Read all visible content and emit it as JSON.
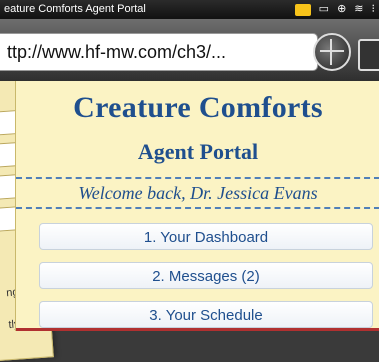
{
  "statusbar": {
    "title": "eature Comforts Agent Portal"
  },
  "browser": {
    "url": "ttp://www.hf-mw.com/ch3/..."
  },
  "page": {
    "title": "Creature Comforts",
    "subtitle": "Agent Portal",
    "welcome": "Welcome back, Dr. Jessica Evans",
    "nav": [
      {
        "label": "1. Your Dashboard"
      },
      {
        "label": "2. Messages (2)"
      },
      {
        "label": "3. Your Schedule"
      }
    ]
  },
  "back_page": {
    "text1": "ng",
    "text2": "tly"
  },
  "colors": {
    "accent": "#1f4f8e",
    "page_bg": "#fbf3c4",
    "statusbar_bg": "#111111"
  },
  "icons": [
    "chat-icon",
    "battery-icon",
    "signal-icon",
    "wifi-icon",
    "network-icon",
    "globe-icon",
    "tabs-icon"
  ]
}
